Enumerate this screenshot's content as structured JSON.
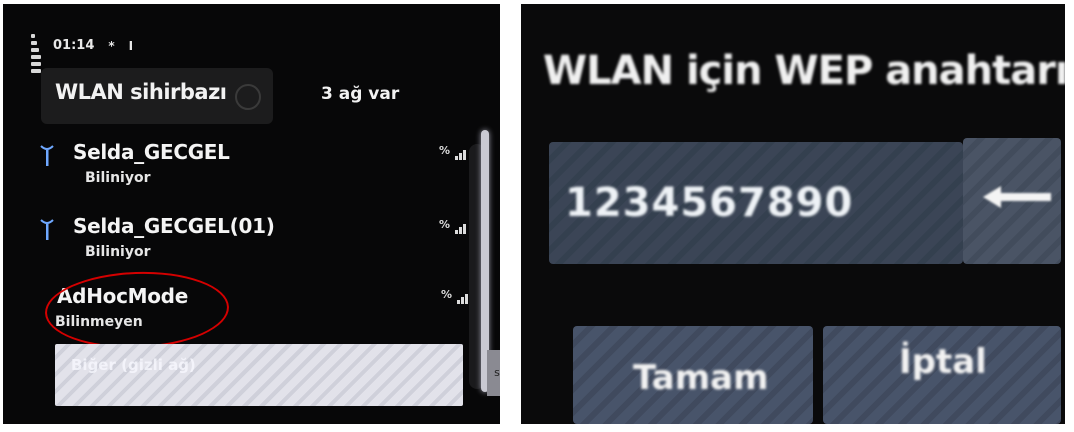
{
  "left": {
    "status": {
      "time": "01:14",
      "mark1": "*",
      "mark2": "I"
    },
    "header": {
      "title": "WLAN sihirbazı",
      "count": "3 ağ var"
    },
    "networks": [
      {
        "name": "Selda_GECGEL",
        "status": "Biliniyor",
        "signal": "%"
      },
      {
        "name": "Selda_GECGEL(01)",
        "status": "Biliniyor",
        "signal": "%"
      },
      {
        "name": "AdHocMode",
        "status": "Bilinmeyen",
        "signal": "%"
      }
    ],
    "define_button": "Biğer (gizli ağ)",
    "side_tab": "s"
  },
  "right": {
    "title": "WLAN için WEP anahtarı:",
    "key_value": "1234567890",
    "ok_label": "Tamam",
    "cancel_label": "İptal"
  },
  "colors": {
    "highlight": "#d40000",
    "background": "#070708",
    "field": "#3b4556"
  }
}
